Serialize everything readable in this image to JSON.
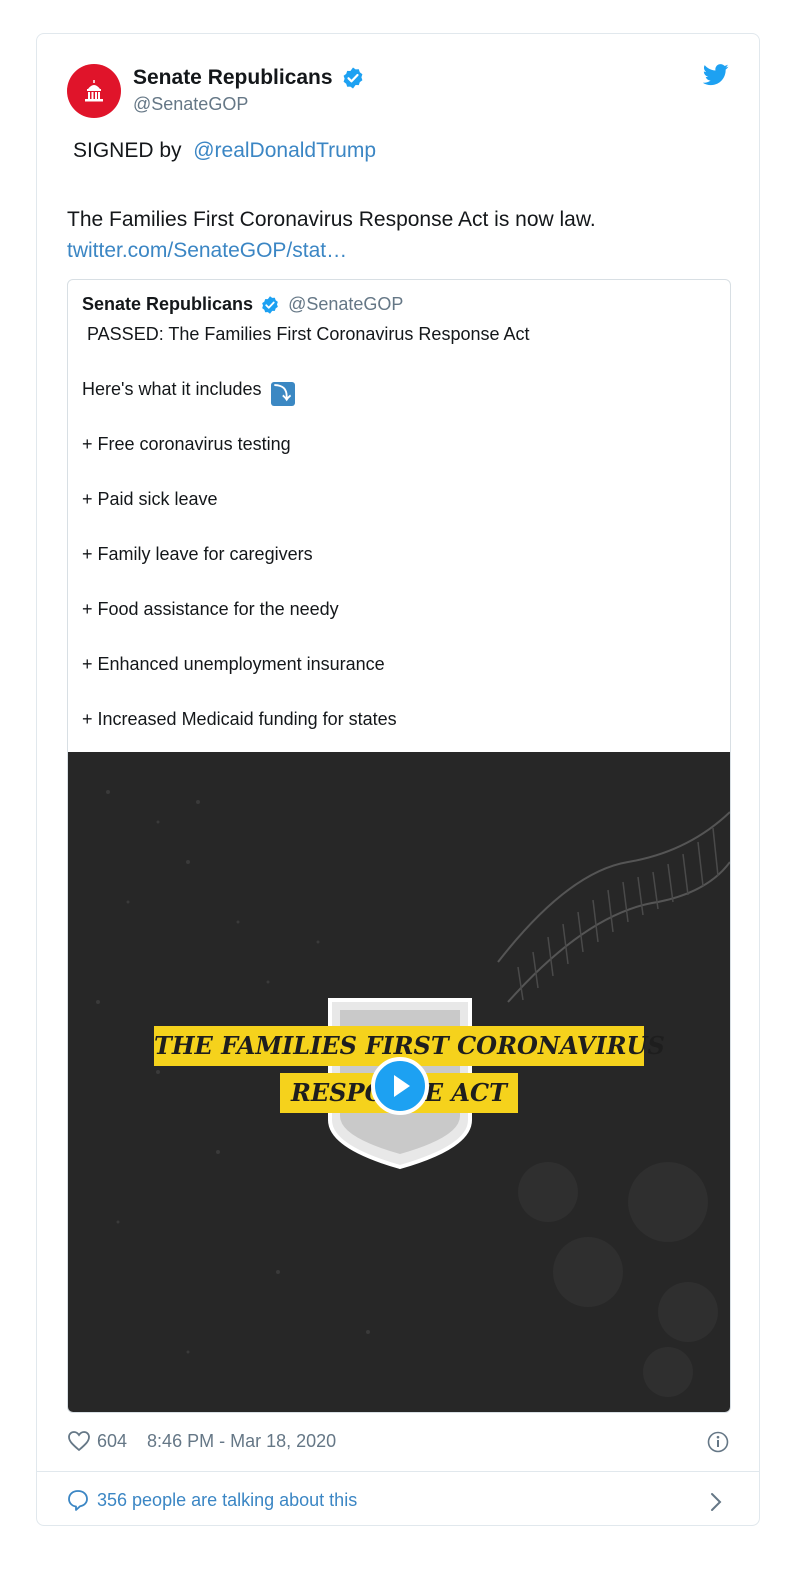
{
  "tweet": {
    "author_name": "Senate Republicans",
    "author_handle": "@SenateGOP",
    "signed_prefix": "SIGNED by ",
    "signed_mention": "@realDonaldTrump",
    "body": "The Families First Coronavirus Response Act is now law.",
    "link": "twitter.com/SenateGOP/stat…",
    "likes": "604",
    "timestamp": "8:46 PM - Mar 18, 2020",
    "talking": "356 people are talking about this"
  },
  "quote": {
    "author_name": "Senate Republicans",
    "author_handle": "@SenateGOP",
    "lines": [
      " PASSED: The Families First Coronavirus Response Act",
      "Here's what it includes ",
      "+ Free coronavirus testing",
      "+ Paid sick leave",
      "+ Family leave for caregivers",
      "+ Food assistance for the needy",
      "+ Enhanced unemployment insurance",
      "+ Increased Medicaid funding for states"
    ],
    "arrow_emoji": "⤵",
    "video": {
      "banner_line1": "THE FAMILIES FIRST CORONAVIRUS",
      "banner_line2": "RESPONSE ACT"
    }
  },
  "colors": {
    "accent": "#3b86c4",
    "verified": "#1da1f2",
    "avatar": "#e0142a",
    "banner": "#f5d21c"
  },
  "icons": [
    "capitol-icon",
    "verified-icon",
    "twitter-bird-icon",
    "heart-icon",
    "info-icon",
    "comment-icon",
    "chevron-right-icon",
    "play-icon"
  ]
}
